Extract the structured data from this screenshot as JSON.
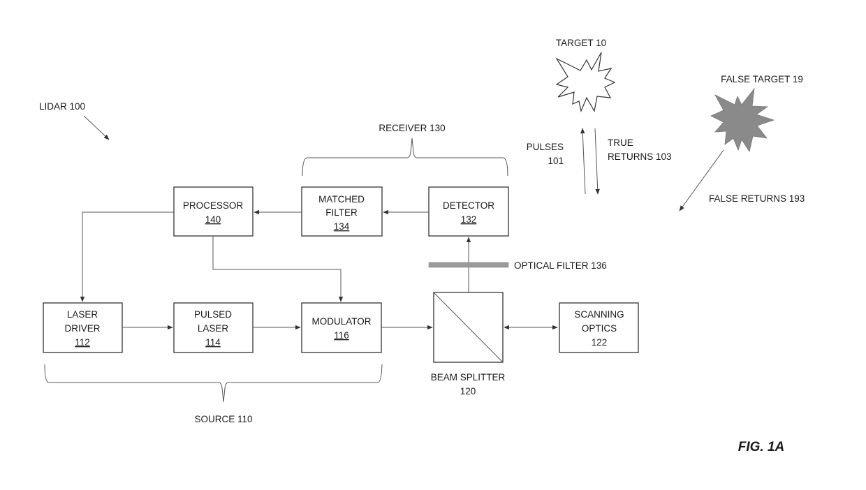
{
  "figure_label": "FIG. 1A",
  "system_label": "LIDAR 100",
  "groups": {
    "receiver": "RECEIVER 130",
    "source": "SOURCE 110"
  },
  "blocks": {
    "processor": {
      "line1": "PROCESSOR",
      "line2": "",
      "ref": "140"
    },
    "matched_filter": {
      "line1": "MATCHED",
      "line2": "FILTER",
      "ref": "134"
    },
    "detector": {
      "line1": "DETECTOR",
      "line2": "",
      "ref": "132"
    },
    "laser_driver": {
      "line1": "LASER",
      "line2": "DRIVER",
      "ref": "112"
    },
    "pulsed_laser": {
      "line1": "PULSED",
      "line2": "LASER",
      "ref": "114"
    },
    "modulator": {
      "line1": "MODULATOR",
      "line2": "",
      "ref": "116"
    },
    "scanning_optics": {
      "line1": "SCANNING",
      "line2": "OPTICS",
      "ref": "122"
    }
  },
  "beam_splitter": {
    "line1": "BEAM SPLITTER",
    "line2": "120"
  },
  "optical_filter": "OPTICAL FILTER 136",
  "targets": {
    "target": "TARGET 10",
    "false_target": "FALSE TARGET 19"
  },
  "signals": {
    "pulses_line1": "PULSES",
    "pulses_line2": "101",
    "true_returns_line1": "TRUE",
    "true_returns_line2": "RETURNS 103",
    "false_returns": "FALSE RETURNS 193"
  },
  "colors": {
    "line": "#555555",
    "box_stroke": "#333333",
    "false_target_fill": "#8a8a8a",
    "optical_filter_fill": "#9a9a9a"
  }
}
